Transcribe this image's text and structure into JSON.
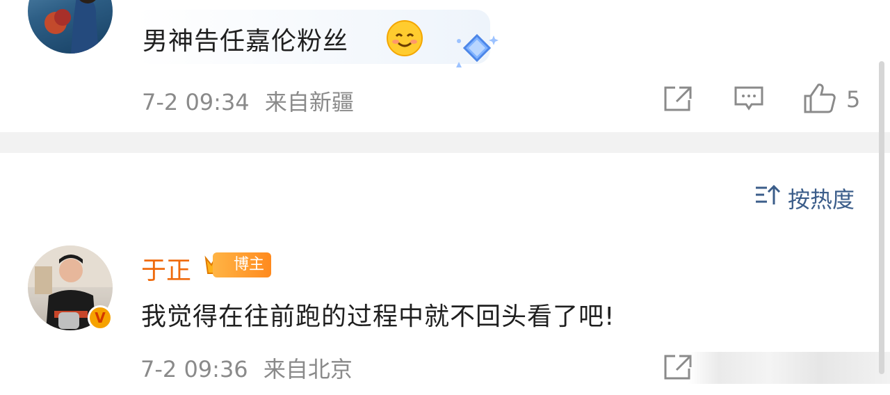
{
  "comment1": {
    "username": "—",
    "content": "男神告任嘉伦粉丝",
    "time": "7-2 09:34",
    "location": "来自新疆",
    "like_count": "5"
  },
  "sort": {
    "label": "按热度"
  },
  "comment2": {
    "username": "于正",
    "badge_label": "博主",
    "content": "我觉得在往前跑的过程中就不回头看了吧!",
    "time": "7-2 09:36",
    "location": "来自北京"
  },
  "colors": {
    "accent": "#ef6a0c",
    "link": "#3b5d8a",
    "meta": "#8a8a8a"
  },
  "icons": [
    "share-icon",
    "comment-icon",
    "like-icon",
    "emoji-smile-icon",
    "diamond-sticker-icon",
    "crown-badge-icon",
    "verified-v-icon"
  ]
}
